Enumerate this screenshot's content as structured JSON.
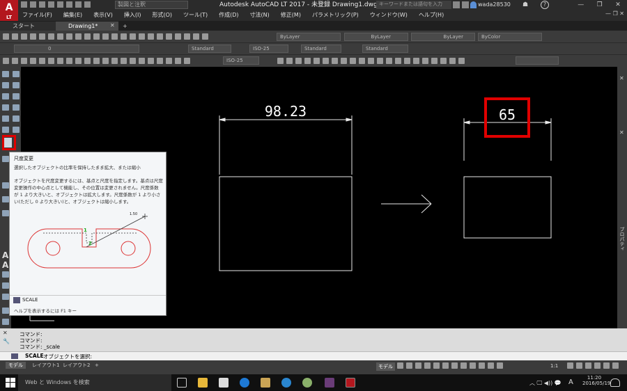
{
  "titlebar": {
    "logo": "A",
    "logo_sub": "LT",
    "workspace_dropdown": "製図と注釈",
    "app_title": "Autodesk AutoCAD LT 2017 - 未登録    Drawing1.dwg",
    "search_placeholder": "キーワードまたは語句を入力",
    "username": "wada28530",
    "window_controls": [
      "—",
      "❐",
      "✕"
    ]
  },
  "menu": {
    "items": [
      "ファイル(F)",
      "編集(E)",
      "表示(V)",
      "挿入(I)",
      "形式(O)",
      "ツール(T)",
      "作成(D)",
      "寸法(N)",
      "修正(M)",
      "パラメトリック(P)",
      "ウィンドウ(W)",
      "ヘルプ(H)"
    ],
    "right_controls": "— ❐ ✕"
  },
  "tabs": [
    {
      "label": "スタート"
    },
    {
      "label": "Drawing1*"
    },
    {
      "label": "+"
    }
  ],
  "properties_toolbar": {
    "layer_value": "ByLayer",
    "linetype_value": "ByLayer",
    "lineweight_value": "ByLayer",
    "color_value": "ByColor"
  },
  "styles_toolbar": {
    "layer_name": "0",
    "text_style": "Standard",
    "dim_style": "ISO-25",
    "table_style": "Standard",
    "mleader_style": "Standard"
  },
  "dim_toolbar": {
    "dim_style": "ISO-25"
  },
  "drawing": {
    "dim_left": "98.23",
    "dim_right": "65",
    "arrow": "→"
  },
  "right_panel": {
    "label": "プロパティ"
  },
  "tooltip": {
    "title": "尺度変更",
    "subtitle": "選択したオブジェクトの比率を保持したまま拡大、または縮小",
    "body": "オブジェクトを尺度変更するには、基点と尺度を指定します。基点は尺度変更操作の中心点として機能し、その位置は変更されません。尺度係数が 1 より大きいと、オブジェクトは拡大します。尺度係数が 1 より小さい(ただし 0 より大きい)と、オブジェクトは縮小します。",
    "illus_scale": "1.50",
    "illus_point1": "1",
    "illus_point2": "2",
    "command_name": "SCALE",
    "help_text": "ヘルプを表示するには F1 キー"
  },
  "command_window": {
    "history": [
      "コマンド:",
      "コマンド:",
      "コマンド:  _scale"
    ],
    "prompt_cmd": "SCALE",
    "prompt_text": "オブジェクトを選択:"
  },
  "layout_tabs": [
    "モデル",
    "レイアウト1",
    "レイアウト2",
    "+"
  ],
  "statusbar": {
    "model_label": "モデル",
    "scale": "1:1"
  },
  "taskbar": {
    "search_placeholder": "Web と Windows を検索",
    "ime": "A",
    "time": "11:20",
    "date": "2016/05/19"
  },
  "colors": {
    "highlight": "#e00000",
    "logo_red": "#b3171e",
    "toolbar_bg": "#3b3b3b",
    "canvas_bg": "#000000"
  }
}
